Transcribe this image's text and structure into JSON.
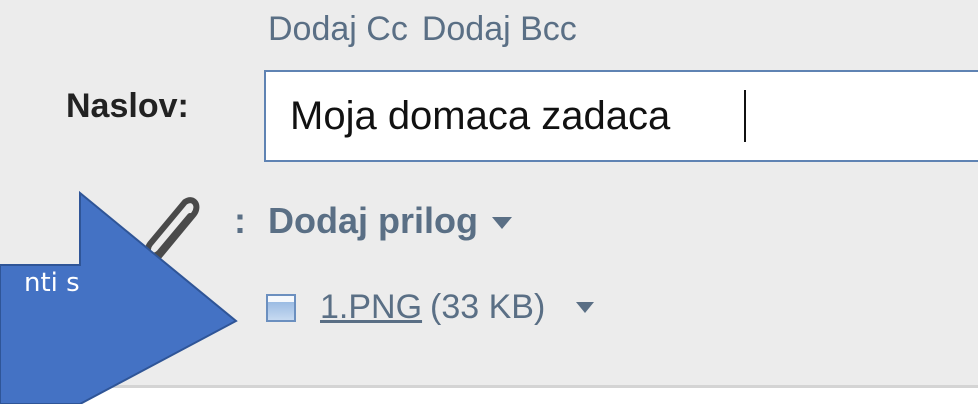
{
  "compose": {
    "add_cc": "Dodaj Cc",
    "add_bcc": "Dodaj Bcc",
    "subject_label": "Naslov:",
    "subject_value": "Moja domaca zadaca",
    "attachment_colon": ":",
    "add_attachment": "Dodaj prilog",
    "attachments": [
      {
        "name": "1.PNG",
        "size": "(33 KB)"
      }
    ]
  },
  "annotation": {
    "callout_text": "nti s",
    "color": "#4472c4"
  },
  "colors": {
    "link": "#5a6f85",
    "field_border": "#5f83b3",
    "panel_bg": "#ececec"
  },
  "icons": [
    "paperclip-icon",
    "dropdown-arrow-icon",
    "image-file-icon"
  ]
}
